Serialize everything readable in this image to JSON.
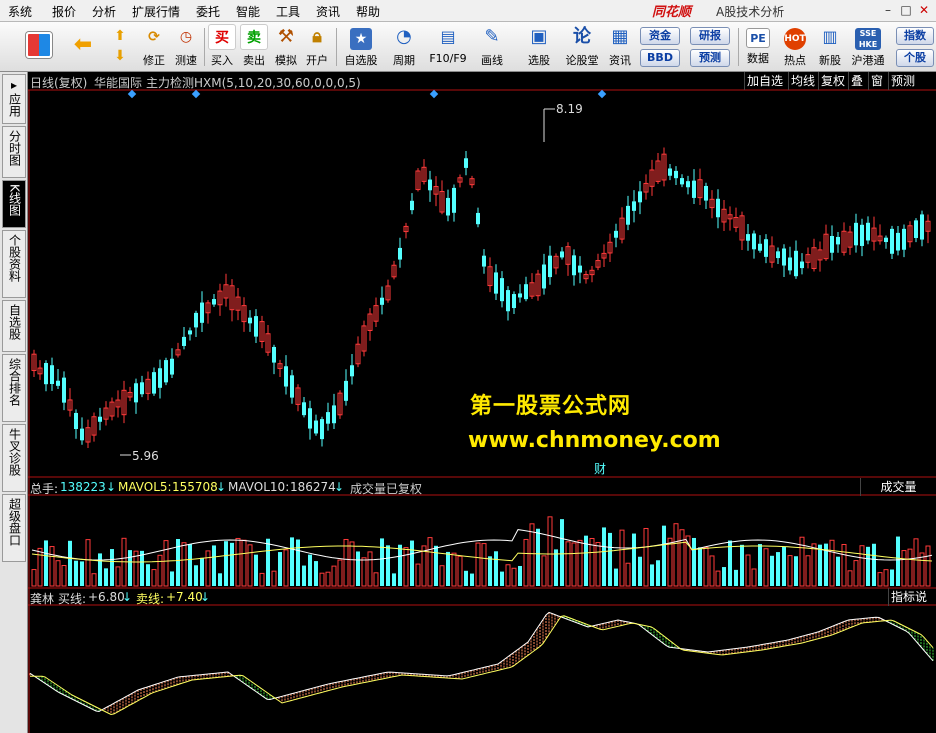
{
  "menu": [
    "系统",
    "报价",
    "分析",
    "扩展行情",
    "委托",
    "智能",
    "工具",
    "资讯",
    "帮助"
  ],
  "brand": "同花顺",
  "app_title": "A股技术分析",
  "toolbar": {
    "buttons": [
      {
        "label": "修正",
        "icon": "refresh-icon"
      },
      {
        "label": "测速",
        "icon": "clock-icon"
      },
      {
        "label": "买入",
        "icon": "buy-icon",
        "glyph": "买"
      },
      {
        "label": "卖出",
        "icon": "sell-icon",
        "glyph": "卖"
      },
      {
        "label": "模拟",
        "icon": "hammer-icon"
      },
      {
        "label": "开户",
        "icon": "lock-icon"
      },
      {
        "label": "自选股",
        "icon": "star-icon"
      },
      {
        "label": "周期",
        "icon": "cycle-icon"
      },
      {
        "label": "F10/F9",
        "icon": "f10-icon"
      },
      {
        "label": "画线",
        "icon": "pen-icon"
      },
      {
        "label": "选股",
        "icon": "monitor-icon"
      },
      {
        "label": "论股堂",
        "icon": "discuss-icon",
        "glyph": "论"
      },
      {
        "label": "资讯",
        "icon": "news-icon"
      },
      {
        "label": "数据",
        "icon": "pe-icon",
        "glyph": "PE"
      },
      {
        "label": "热点",
        "icon": "hot-icon"
      },
      {
        "label": "新股",
        "icon": "newstock-icon"
      },
      {
        "label": "沪港通",
        "icon": "hk-icon"
      }
    ],
    "small": {
      "zijin": "资金",
      "yanbao": "研报",
      "bbd": "BBD",
      "yuce": "预测",
      "zhishu": "指数",
      "gegu": "个股"
    }
  },
  "left_tabs": [
    {
      "label": "应用"
    },
    {
      "label": "分时图"
    },
    {
      "label": "K线图",
      "active": true
    },
    {
      "label": "个股资料"
    },
    {
      "label": "自选股"
    },
    {
      "label": "综合排名"
    },
    {
      "label": "牛叉诊股"
    },
    {
      "label": "超级盘口"
    }
  ],
  "chart_header": {
    "period": "日线(复权)",
    "stock_name": "华能国际",
    "indicator": "主力检测HXM(5,10,20,30,60,0,0,0,5)"
  },
  "right_buttons": [
    "加自选",
    "均线",
    "复权",
    "叠",
    "窗",
    "预测"
  ],
  "price_labels": {
    "high": "8.19",
    "low": "5.96"
  },
  "finance_marker": "财",
  "watermark": {
    "line1": "第一股票公式网",
    "line2": "www.chnmoney.com"
  },
  "volume_pane": {
    "total_label": "总手:",
    "total_value": "138223",
    "mavol5_label": "MAVOL5:",
    "mavol5_value": "155708",
    "mavol10_label": "MAVOL10:",
    "mavol10_value": "186274",
    "note": "成交量已复权",
    "tab": "成交量"
  },
  "indicator_pane": {
    "name": "龚林",
    "buy_label": "买线:",
    "buy_value": "+6.80",
    "sell_label": "卖线:",
    "sell_value": "+7.40",
    "tab": "指标说明"
  },
  "colors": {
    "up": "#ff3a3a",
    "down": "#54ffff",
    "up_vol": "#ff3a3a",
    "down_vol": "#54ffff",
    "buy_line": "#ffffff",
    "sell_line": "#ffff60",
    "axis": "#b01010"
  }
}
